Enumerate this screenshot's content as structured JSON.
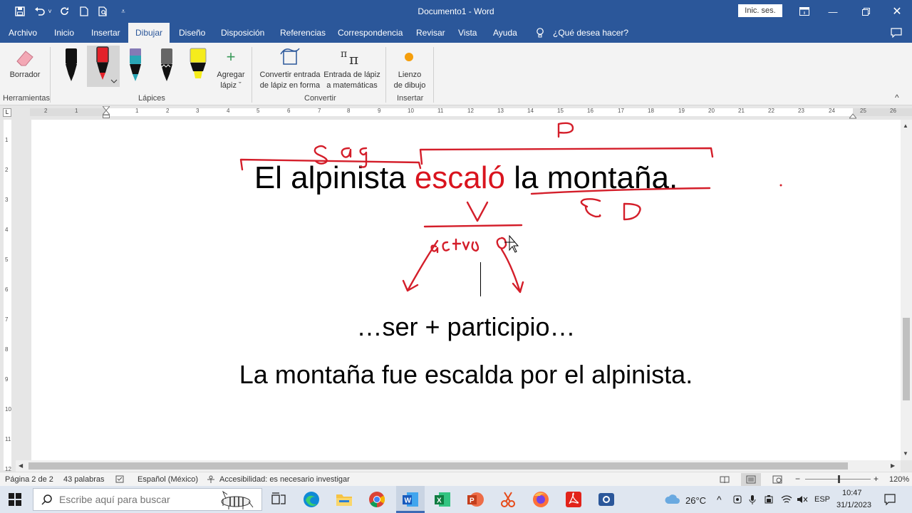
{
  "titlebar": {
    "doc_title": "Documento1  -  Word",
    "signin": "Inic. ses."
  },
  "tabs": [
    {
      "label": "Archivo"
    },
    {
      "label": "Inicio"
    },
    {
      "label": "Insertar"
    },
    {
      "label": "Dibujar"
    },
    {
      "label": "Diseño"
    },
    {
      "label": "Disposición"
    },
    {
      "label": "Referencias"
    },
    {
      "label": "Correspondencia"
    },
    {
      "label": "Revisar"
    },
    {
      "label": "Vista"
    },
    {
      "label": "Ayuda"
    },
    {
      "label": "¿Qué desea hacer?"
    }
  ],
  "ribbon": {
    "eraser_label": "Borrador",
    "add_pen_label_1": "Agregar",
    "add_pen_label_2": "lápiz ˇ",
    "convert_shape_1": "Convertir entrada",
    "convert_shape_2": "de lápiz en forma",
    "convert_math_1": "Entrada de lápiz",
    "convert_math_2": "a matemáticas",
    "canvas_1": "Lienzo",
    "canvas_2": "de dibujo",
    "groups": {
      "tools": "Herramientas",
      "pens": "Lápices",
      "convert": "Convertir",
      "insert": "Insertar"
    },
    "pen_colors": [
      "#111111",
      "#e3222a",
      "#2aa6b5",
      "#222222",
      "#f5ec1c"
    ]
  },
  "ruler": {
    "labels": [
      "2",
      "1",
      "1",
      "2",
      "3",
      "4",
      "5",
      "6",
      "7",
      "8",
      "9",
      "10",
      "11",
      "12",
      "13",
      "14",
      "15",
      "16",
      "17",
      "18",
      "19",
      "20",
      "21",
      "22",
      "23",
      "24",
      "25",
      "26"
    ]
  },
  "vruler": {
    "labels": [
      "1",
      "2",
      "3",
      "4",
      "5",
      "6",
      "7",
      "8",
      "9",
      "10",
      "11",
      "12"
    ]
  },
  "document": {
    "sentence1_part1": "El alpinista ",
    "sentence1_verb": "escaló",
    "sentence1_part2": " la montaña.",
    "sentence2": "…ser + participio…",
    "sentence3": "La montaña fue escalda por el alpinista.",
    "ink": {
      "label_s_ag": "S. ag.",
      "label_p": "P",
      "label_v": "V",
      "label_cd": "CD",
      "label_activo": "activo"
    }
  },
  "statusbar": {
    "page": "Página 2 de 2",
    "words": "43 palabras",
    "language": "Español (México)",
    "accessibility": "Accesibilidad: es necesario investigar",
    "zoom": "120%"
  },
  "taskbar": {
    "search_placeholder": "Escribe aquí para buscar",
    "temperature": "26°C",
    "lang": "ESP",
    "time": "10:47",
    "date": "31/1/2023"
  }
}
